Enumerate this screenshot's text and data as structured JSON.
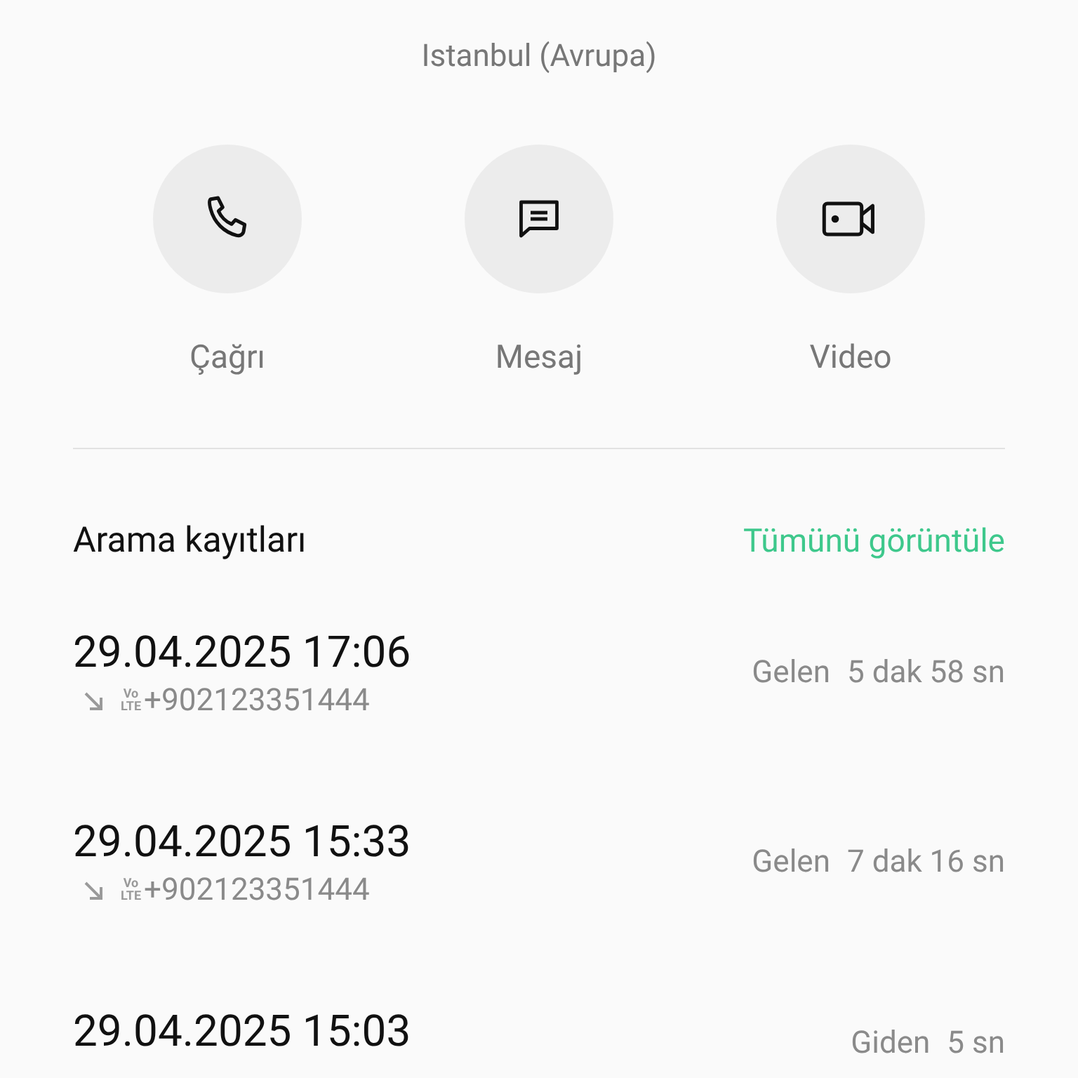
{
  "location": "Istanbul (Avrupa)",
  "actions": [
    {
      "kind": "call",
      "label": "Çağrı"
    },
    {
      "kind": "message",
      "label": "Mesaj"
    },
    {
      "kind": "video",
      "label": "Video"
    }
  ],
  "call_log": {
    "title": "Arama kayıtları",
    "view_all": "Tümünü görüntüle",
    "entries": [
      {
        "datetime": "29.04.2025 17:06",
        "kind": "incoming",
        "volte": [
          "Vo",
          "LTE"
        ],
        "number": "+902123351444",
        "direction": "Gelen",
        "duration": "5 dak 58 sn"
      },
      {
        "datetime": "29.04.2025 15:33",
        "kind": "incoming",
        "volte": [
          "Vo",
          "LTE"
        ],
        "number": "+902123351444",
        "direction": "Gelen",
        "duration": "7 dak 16 sn"
      },
      {
        "datetime": "29.04.2025 15:03",
        "direction": "Giden",
        "duration": "5 sn"
      }
    ]
  }
}
